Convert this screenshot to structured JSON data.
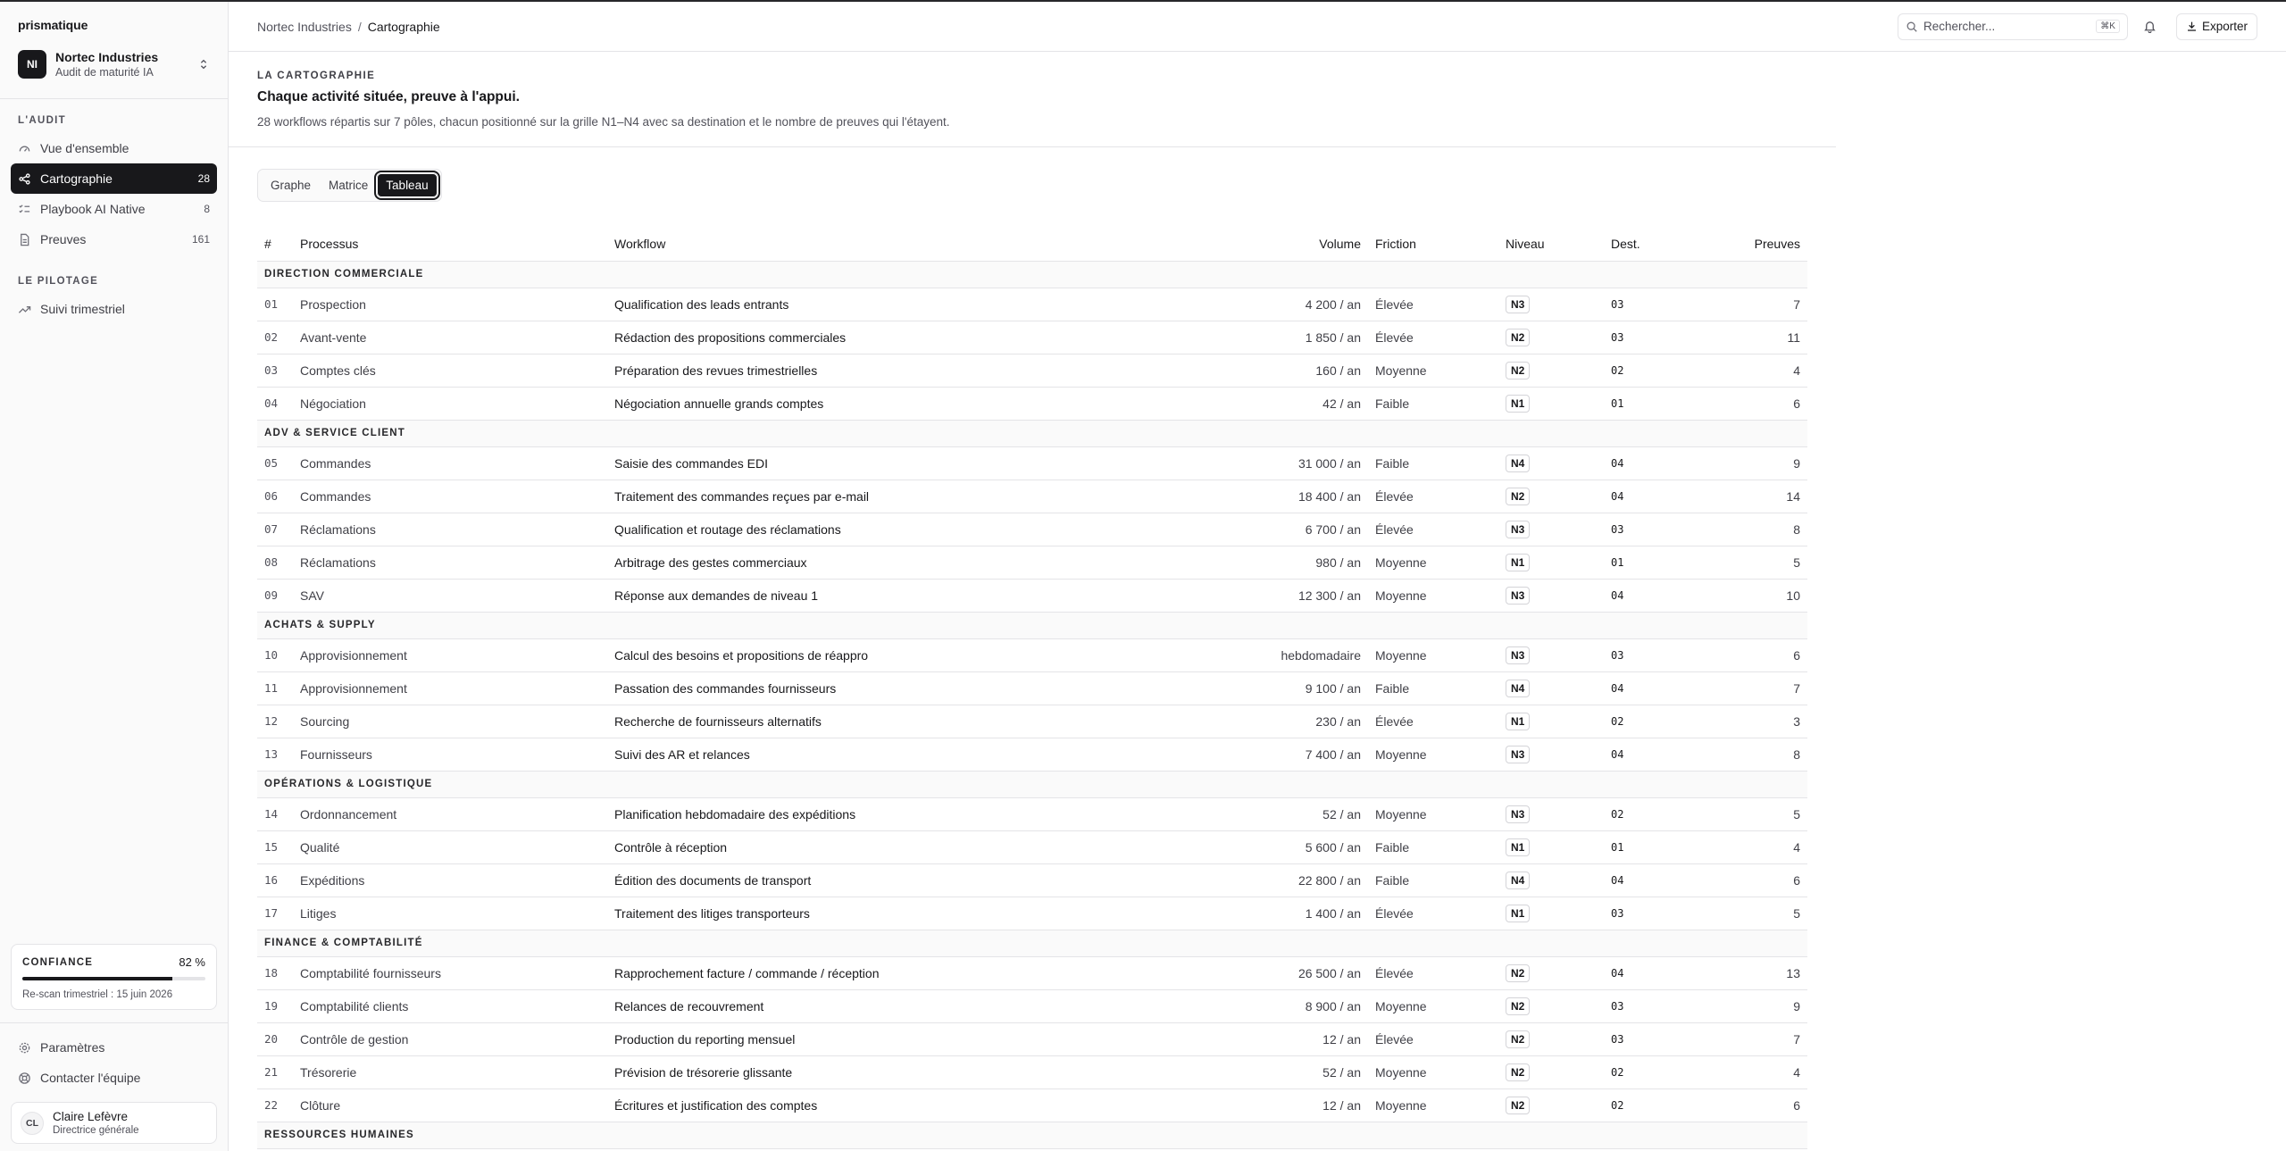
{
  "brand": "prismatique",
  "org": {
    "initials": "NI",
    "name": "Nortec Industries",
    "subtitle": "Audit de maturité IA"
  },
  "nav": {
    "audit_title": "L'AUDIT",
    "audit_items": [
      {
        "label": "Vue d'ensemble",
        "count": "",
        "icon": "gauge-icon"
      },
      {
        "label": "Cartographie",
        "count": "28",
        "icon": "share-nodes-icon"
      },
      {
        "label": "Playbook AI Native",
        "count": "8",
        "icon": "list-checks-icon"
      },
      {
        "label": "Preuves",
        "count": "161",
        "icon": "document-icon"
      }
    ],
    "pilotage_title": "LE PILOTAGE",
    "pilotage_items": [
      {
        "label": "Suivi trimestriel",
        "icon": "trend-up-icon"
      }
    ]
  },
  "confidence": {
    "title": "CONFIANCE",
    "value": "82 %",
    "level": 0.82,
    "note": "Re-scan trimestriel : 15 juin 2026"
  },
  "footer": {
    "settings": "Paramètres",
    "contact": "Contacter l'équipe",
    "user": {
      "initials": "CL",
      "name": "Claire Lefèvre",
      "role": "Directrice générale"
    }
  },
  "topbar": {
    "breadcrumb_parent": "Nortec Industries",
    "breadcrumb_sep": "/",
    "breadcrumb_current": "Cartographie",
    "search_placeholder": "Rechercher...",
    "search_shortcut": "⌘K",
    "export_label": "Exporter"
  },
  "intro": {
    "eyebrow": "LA CARTOGRAPHIE",
    "headline": "Chaque activité située, preuve à l'appui.",
    "lede": "28 workflows répartis sur 7 pôles, chacun positionné sur la grille N1–N4 avec sa destination et le nombre de preuves qui l'étayent."
  },
  "tabs": [
    "Graphe",
    "Matrice",
    "Tableau"
  ],
  "active_tab": 2,
  "table": {
    "headers": {
      "idx": "#",
      "proc": "Processus",
      "wf": "Workflow",
      "vol": "Volume",
      "fric": "Friction",
      "lvl": "Niveau",
      "dest": "Dest.",
      "prv": "Preuves"
    },
    "groups": [
      {
        "name": "DIRECTION COMMERCIALE",
        "rows": [
          [
            "01",
            "Prospection",
            "Qualification des leads entrants",
            "4 200 / an",
            "Élevée",
            "N3",
            "03",
            "7"
          ],
          [
            "02",
            "Avant-vente",
            "Rédaction des propositions commerciales",
            "1 850 / an",
            "Élevée",
            "N2",
            "03",
            "11"
          ],
          [
            "03",
            "Comptes clés",
            "Préparation des revues trimestrielles",
            "160 / an",
            "Moyenne",
            "N2",
            "02",
            "4"
          ],
          [
            "04",
            "Négociation",
            "Négociation annuelle grands comptes",
            "42 / an",
            "Faible",
            "N1",
            "01",
            "6"
          ]
        ]
      },
      {
        "name": "ADV & SERVICE CLIENT",
        "rows": [
          [
            "05",
            "Commandes",
            "Saisie des commandes EDI",
            "31 000 / an",
            "Faible",
            "N4",
            "04",
            "9"
          ],
          [
            "06",
            "Commandes",
            "Traitement des commandes reçues par e-mail",
            "18 400 / an",
            "Élevée",
            "N2",
            "04",
            "14"
          ],
          [
            "07",
            "Réclamations",
            "Qualification et routage des réclamations",
            "6 700 / an",
            "Élevée",
            "N3",
            "03",
            "8"
          ],
          [
            "08",
            "Réclamations",
            "Arbitrage des gestes commerciaux",
            "980 / an",
            "Moyenne",
            "N1",
            "01",
            "5"
          ],
          [
            "09",
            "SAV",
            "Réponse aux demandes de niveau 1",
            "12 300 / an",
            "Moyenne",
            "N3",
            "04",
            "10"
          ]
        ]
      },
      {
        "name": "ACHATS & SUPPLY",
        "rows": [
          [
            "10",
            "Approvisionnement",
            "Calcul des besoins et propositions de réappro",
            "hebdomadaire",
            "Moyenne",
            "N3",
            "03",
            "6"
          ],
          [
            "11",
            "Approvisionnement",
            "Passation des commandes fournisseurs",
            "9 100 / an",
            "Faible",
            "N4",
            "04",
            "7"
          ],
          [
            "12",
            "Sourcing",
            "Recherche de fournisseurs alternatifs",
            "230 / an",
            "Élevée",
            "N1",
            "02",
            "3"
          ],
          [
            "13",
            "Fournisseurs",
            "Suivi des AR et relances",
            "7 400 / an",
            "Moyenne",
            "N3",
            "04",
            "8"
          ]
        ]
      },
      {
        "name": "OPÉRATIONS & LOGISTIQUE",
        "rows": [
          [
            "14",
            "Ordonnancement",
            "Planification hebdomadaire des expéditions",
            "52 / an",
            "Moyenne",
            "N3",
            "02",
            "5"
          ],
          [
            "15",
            "Qualité",
            "Contrôle à réception",
            "5 600 / an",
            "Faible",
            "N1",
            "01",
            "4"
          ],
          [
            "16",
            "Expéditions",
            "Édition des documents de transport",
            "22 800 / an",
            "Faible",
            "N4",
            "04",
            "6"
          ],
          [
            "17",
            "Litiges",
            "Traitement des litiges transporteurs",
            "1 400 / an",
            "Élevée",
            "N1",
            "03",
            "5"
          ]
        ]
      },
      {
        "name": "FINANCE & COMPTABILITÉ",
        "rows": [
          [
            "18",
            "Comptabilité fournisseurs",
            "Rapprochement facture / commande / réception",
            "26 500 / an",
            "Élevée",
            "N2",
            "04",
            "13"
          ],
          [
            "19",
            "Comptabilité clients",
            "Relances de recouvrement",
            "8 900 / an",
            "Moyenne",
            "N2",
            "03",
            "9"
          ],
          [
            "20",
            "Contrôle de gestion",
            "Production du reporting mensuel",
            "12 / an",
            "Élevée",
            "N2",
            "03",
            "7"
          ],
          [
            "21",
            "Trésorerie",
            "Prévision de trésorerie glissante",
            "52 / an",
            "Moyenne",
            "N2",
            "02",
            "4"
          ],
          [
            "22",
            "Clôture",
            "Écritures et justification des comptes",
            "12 / an",
            "Moyenne",
            "N2",
            "02",
            "6"
          ]
        ]
      },
      {
        "name": "RESSOURCES HUMAINES",
        "rows": []
      }
    ]
  },
  "colors": {
    "accent": "#18181b",
    "border": "#e4e4e7",
    "muted": "#52525b",
    "sidebar_bg": "#fafafa"
  }
}
